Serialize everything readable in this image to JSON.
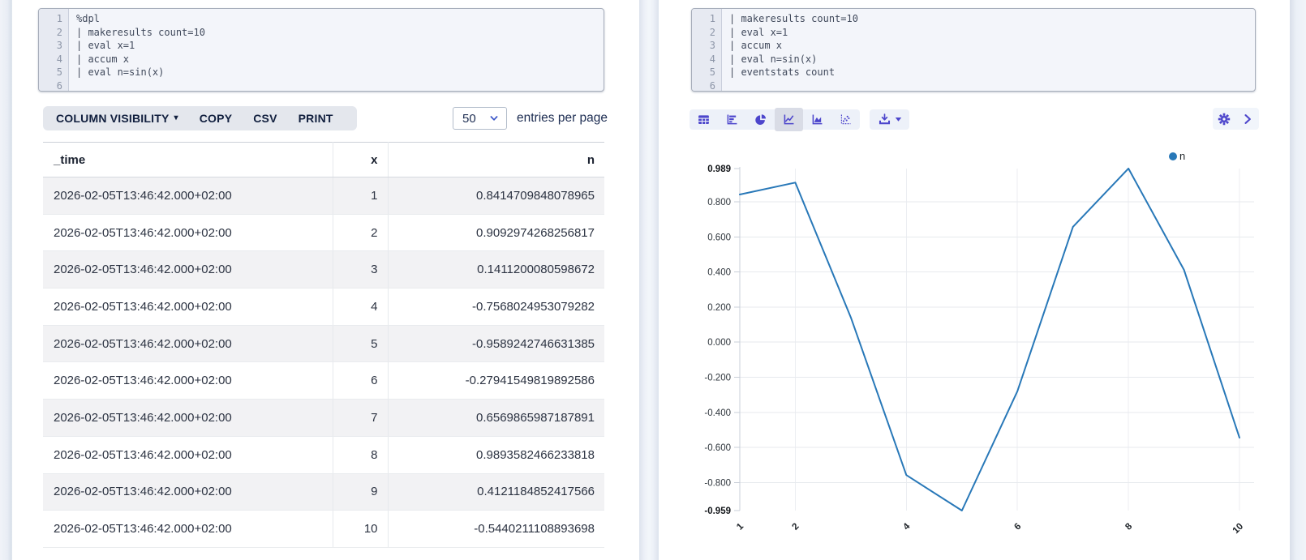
{
  "colors": {
    "accent_indigo": "#4d46cc",
    "series_blue": "#2878b8",
    "stripe_gray": "#f2f2f4",
    "selected_icon_bg": "#d9dce6"
  },
  "left_cell": {
    "code": {
      "lines": [
        "%dpl",
        "| makeresults count=10",
        "| eval x=1",
        "| accum x",
        "| eval n=sin(x)",
        ""
      ]
    },
    "toolbar": {
      "column_visibility_label": "COLUMN VISIBILITY",
      "copy_label": "COPY",
      "csv_label": "CSV",
      "print_label": "PRINT"
    },
    "pagination": {
      "page_size_value": "50",
      "entries_label": "entries per page"
    },
    "table": {
      "columns": [
        "_time",
        "x",
        "n"
      ],
      "rows": [
        {
          "time": "2026-02-05T13:46:42.000+02:00",
          "x": "1",
          "n": "0.8414709848078965"
        },
        {
          "time": "2026-02-05T13:46:42.000+02:00",
          "x": "2",
          "n": "0.9092974268256817"
        },
        {
          "time": "2026-02-05T13:46:42.000+02:00",
          "x": "3",
          "n": "0.1411200080598672"
        },
        {
          "time": "2026-02-05T13:46:42.000+02:00",
          "x": "4",
          "n": "-0.7568024953079282"
        },
        {
          "time": "2026-02-05T13:46:42.000+02:00",
          "x": "5",
          "n": "-0.9589242746631385"
        },
        {
          "time": "2026-02-05T13:46:42.000+02:00",
          "x": "6",
          "n": "-0.27941549819892586"
        },
        {
          "time": "2026-02-05T13:46:42.000+02:00",
          "x": "7",
          "n": "0.6569865987187891"
        },
        {
          "time": "2026-02-05T13:46:42.000+02:00",
          "x": "8",
          "n": "0.9893582466233818"
        },
        {
          "time": "2026-02-05T13:46:42.000+02:00",
          "x": "9",
          "n": "0.4121184852417566"
        },
        {
          "time": "2026-02-05T13:46:42.000+02:00",
          "x": "10",
          "n": "-0.5440211108893698"
        }
      ]
    }
  },
  "right_cell": {
    "code": {
      "lines": [
        "| makeresults count=10",
        "| eval x=1",
        "| accum x",
        "| eval n=sin(x)",
        "| eventstats count",
        ""
      ]
    },
    "viz_toolbar": {
      "chart_types": [
        "table",
        "bar",
        "pie",
        "line",
        "area",
        "scatter"
      ],
      "selected_type": "line",
      "download_icon": "download",
      "settings_icon": "gear",
      "expand_icon": "chevron-right"
    }
  },
  "chart_data": {
    "type": "line",
    "title": "",
    "xlabel": "",
    "ylabel": "",
    "grid": true,
    "legend_position": "top-right",
    "line_color": "#2878b8",
    "xlim": [
      1,
      10
    ],
    "ylim": [
      -0.959,
      0.989
    ],
    "series": [
      {
        "name": "n",
        "x": [
          1,
          2,
          3,
          4,
          5,
          6,
          7,
          8,
          9,
          10
        ],
        "values": [
          0.8414709848078965,
          0.9092974268256817,
          0.1411200080598672,
          -0.7568024953079282,
          -0.9589242746631385,
          -0.27941549819892586,
          0.6569865987187891,
          0.9893582466233818,
          0.4121184852417566,
          -0.5440211108893698
        ]
      }
    ],
    "y_ticks": [
      {
        "label": "0.989",
        "value": 0.989,
        "bold": true
      },
      {
        "label": "0.800",
        "value": 0.8,
        "bold": false
      },
      {
        "label": "0.600",
        "value": 0.6,
        "bold": false
      },
      {
        "label": "0.400",
        "value": 0.4,
        "bold": false
      },
      {
        "label": "0.200",
        "value": 0.2,
        "bold": false
      },
      {
        "label": "0.000",
        "value": 0.0,
        "bold": false
      },
      {
        "label": "-0.200",
        "value": -0.2,
        "bold": false
      },
      {
        "label": "-0.400",
        "value": -0.4,
        "bold": false
      },
      {
        "label": "-0.600",
        "value": -0.6,
        "bold": false
      },
      {
        "label": "-0.800",
        "value": -0.8,
        "bold": false
      },
      {
        "label": "-0.959",
        "value": -0.959,
        "bold": true
      }
    ],
    "y_gridlines": [
      0.8,
      0.6,
      0.4,
      0.2,
      0.0,
      -0.2,
      -0.4,
      -0.6,
      -0.8
    ],
    "x_ticks": [
      {
        "label": "1",
        "value": 1
      },
      {
        "label": "2",
        "value": 2
      },
      {
        "label": "4",
        "value": 4
      },
      {
        "label": "6",
        "value": 6
      },
      {
        "label": "8",
        "value": 8
      },
      {
        "label": "10",
        "value": 10
      }
    ]
  }
}
